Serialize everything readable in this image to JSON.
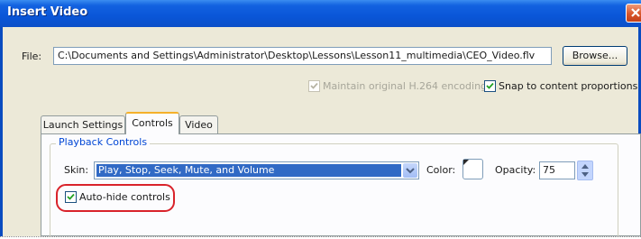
{
  "window": {
    "title": "Insert Video"
  },
  "file": {
    "label": "File:",
    "value": "C:\\Documents and Settings\\Administrator\\Desktop\\Lessons\\Lesson11_multimedia\\CEO_Video.flv",
    "browse_label": "Browse..."
  },
  "options": {
    "maintain_encoding": {
      "label": "Maintain original H.264 encoding",
      "checked": true,
      "enabled": false
    },
    "snap_proportions": {
      "label": "Snap to content proportions",
      "checked": true,
      "enabled": true
    }
  },
  "tabs": [
    {
      "label": "Launch Settings",
      "active": false
    },
    {
      "label": "Controls",
      "active": true
    },
    {
      "label": "Video",
      "active": false
    }
  ],
  "playback": {
    "group_label": "Playback Controls",
    "skin_label": "Skin:",
    "skin_value": "Play, Stop, Seek, Mute, and Volume",
    "color_label": "Color:",
    "color_value": "#ffffff",
    "opacity_label": "Opacity:",
    "opacity_value": "75",
    "autohide": {
      "label": "Auto-hide controls",
      "checked": true
    }
  },
  "colors": {
    "titlebar": "#0a56d8",
    "dialog_bg": "#ece9d8",
    "selection": "#316ac5",
    "highlight_ring": "#d9232b"
  }
}
